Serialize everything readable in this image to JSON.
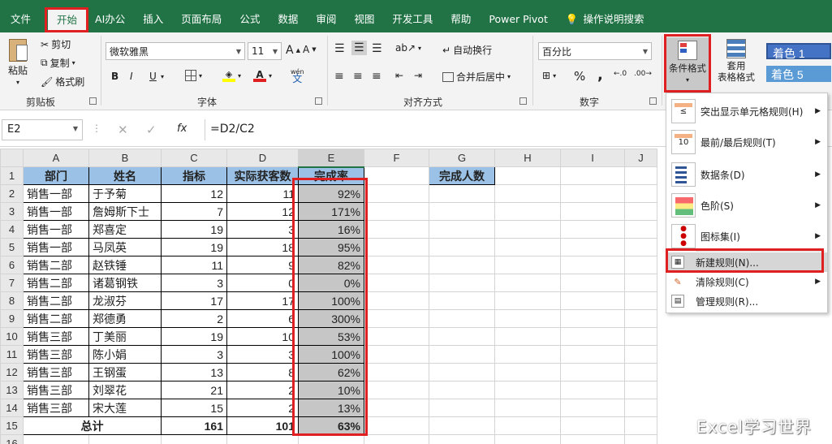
{
  "tabs": [
    "文件",
    "开始",
    "AI办公",
    "插入",
    "页面布局",
    "公式",
    "数据",
    "审阅",
    "视图",
    "开发工具",
    "帮助",
    "Power Pivot",
    "操作说明搜索"
  ],
  "ribbon": {
    "clipboard": {
      "paste": "粘贴",
      "cut": "剪切",
      "copy": "复制",
      "format_painter": "格式刷",
      "label": "剪贴板"
    },
    "font": {
      "name": "微软雅黑",
      "size": "11",
      "bold": "B",
      "italic": "I",
      "underline": "U",
      "label": "字体",
      "phonetic": "wén"
    },
    "alignment": {
      "wrap": "自动换行",
      "merge": "合并后居中",
      "label": "对齐方式"
    },
    "number": {
      "format": "百分比",
      "percent": "%",
      "comma": ",",
      "label": "数字"
    },
    "styles": {
      "conditional_formatting": "条件格式",
      "table_format": "套用\n表格格式",
      "accent1": "着色 1",
      "accent5": "着色 5"
    }
  },
  "formula_bar": {
    "name_box": "E2",
    "fx": "fx",
    "formula": "=D2/C2"
  },
  "columns": [
    "A",
    "B",
    "C",
    "D",
    "E",
    "F",
    "G",
    "H",
    "I",
    "J"
  ],
  "rows": [
    {
      "n": "1",
      "a": "部门",
      "b": "姓名",
      "c": "指标",
      "d": "实际获客数",
      "e": "完成率",
      "g": "完成人数"
    },
    {
      "n": "2",
      "a": "销售一部",
      "b": "于予菊",
      "c": "12",
      "d": "11",
      "e": "92%"
    },
    {
      "n": "3",
      "a": "销售一部",
      "b": "詹姆斯下士",
      "c": "7",
      "d": "12",
      "e": "171%"
    },
    {
      "n": "4",
      "a": "销售一部",
      "b": "郑喜定",
      "c": "19",
      "d": "3",
      "e": "16%"
    },
    {
      "n": "5",
      "a": "销售一部",
      "b": "马凤英",
      "c": "19",
      "d": "18",
      "e": "95%"
    },
    {
      "n": "6",
      "a": "销售二部",
      "b": "赵铁锤",
      "c": "11",
      "d": "9",
      "e": "82%"
    },
    {
      "n": "7",
      "a": "销售二部",
      "b": "诸葛钢铁",
      "c": "3",
      "d": "0",
      "e": "0%"
    },
    {
      "n": "8",
      "a": "销售二部",
      "b": "龙淑芬",
      "c": "17",
      "d": "17",
      "e": "100%"
    },
    {
      "n": "9",
      "a": "销售二部",
      "b": "郑德勇",
      "c": "2",
      "d": "6",
      "e": "300%"
    },
    {
      "n": "10",
      "a": "销售三部",
      "b": "丁美丽",
      "c": "19",
      "d": "10",
      "e": "53%"
    },
    {
      "n": "11",
      "a": "销售三部",
      "b": "陈小娟",
      "c": "3",
      "d": "3",
      "e": "100%"
    },
    {
      "n": "12",
      "a": "销售三部",
      "b": "王钢蛋",
      "c": "13",
      "d": "8",
      "e": "62%"
    },
    {
      "n": "13",
      "a": "销售三部",
      "b": "刘翠花",
      "c": "21",
      "d": "2",
      "e": "10%"
    },
    {
      "n": "14",
      "a": "销售三部",
      "b": "宋大莲",
      "c": "15",
      "d": "2",
      "e": "13%"
    },
    {
      "n": "15",
      "a": "总计",
      "b": "",
      "c": "161",
      "d": "101",
      "e": "63%"
    },
    {
      "n": "16",
      "a": "",
      "b": "",
      "c": "",
      "d": "",
      "e": ""
    }
  ],
  "menu": {
    "items": [
      {
        "label": "突出显示单元格规则(H)",
        "icon": "highlight-rules-icon",
        "submenu": true
      },
      {
        "label": "最前/最后规则(T)",
        "icon": "top-bottom-rules-icon",
        "submenu": true
      },
      {
        "label": "数据条(D)",
        "icon": "data-bars-icon",
        "submenu": true
      },
      {
        "label": "色阶(S)",
        "icon": "color-scales-icon",
        "submenu": true
      },
      {
        "label": "图标集(I)",
        "icon": "icon-sets-icon",
        "submenu": true
      },
      {
        "label": "新建规则(N)...",
        "icon": "new-rule-icon",
        "submenu": false
      },
      {
        "label": "清除规则(C)",
        "icon": "clear-rules-icon",
        "submenu": true
      },
      {
        "label": "管理规则(R)...",
        "icon": "manage-rules-icon",
        "submenu": false
      }
    ]
  },
  "watermark": "Excel学习世界",
  "colors": {
    "excel_green": "#217346",
    "header_blue": "#9bc2e6",
    "selection_gray": "#c6c6c6",
    "highlight_red": "#e02020"
  }
}
